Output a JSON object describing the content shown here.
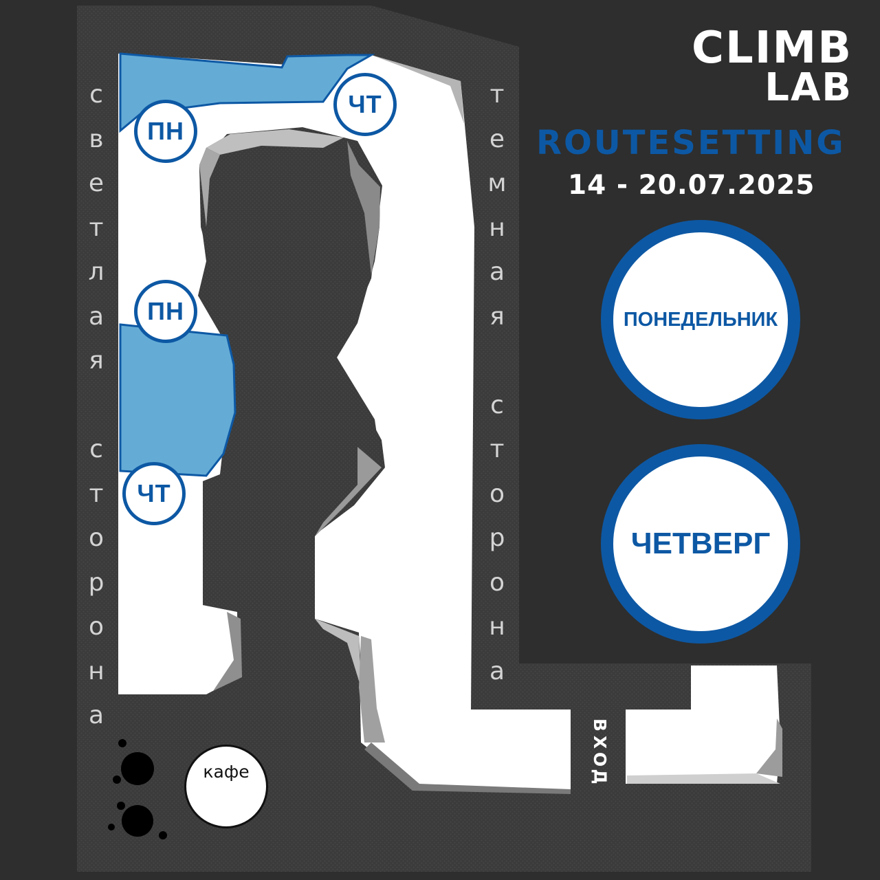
{
  "logo": {
    "line1": "CLIMB",
    "line2": "LAB"
  },
  "title": "ROUTESETTING",
  "dates": "14 - 20.07.2025",
  "legend": [
    {
      "label": "ПОНЕДЕЛЬНИК"
    },
    {
      "label": "ЧЕТВЕРГ"
    }
  ],
  "zone_badges": {
    "monday": "ПН",
    "thursday": "ЧТ"
  },
  "sides": {
    "light": "светлая сторона",
    "dark": "темная сторона"
  },
  "entrance": "вход",
  "cafe": "кафе",
  "colors": {
    "background": "#2e2e2e",
    "floor": "#3a3a3a",
    "accent_blue": "#0d58a4",
    "zone_blue": "#64acd6",
    "wall_white": "#ffffff"
  }
}
